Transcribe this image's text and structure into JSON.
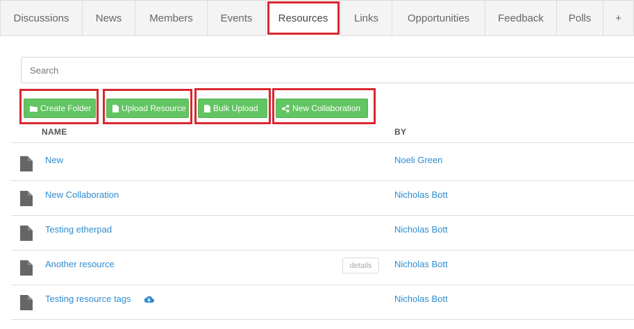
{
  "tabs": [
    {
      "label": "Discussions"
    },
    {
      "label": "News"
    },
    {
      "label": "Members"
    },
    {
      "label": "Events"
    },
    {
      "label": "Resources"
    },
    {
      "label": "Links"
    },
    {
      "label": "Opportunities"
    },
    {
      "label": "Feedback"
    },
    {
      "label": "Polls"
    },
    {
      "label": "+"
    }
  ],
  "active_tab": "Resources",
  "search": {
    "placeholder": "Search"
  },
  "actions": {
    "create_folder": "Create Folder",
    "upload_resource": "Upload Resource",
    "bulk_upload": "Bulk Upload",
    "new_collaboration": "New Collaboration"
  },
  "table": {
    "headers": {
      "name": "NAME",
      "by": "BY"
    },
    "rows": [
      {
        "name": "New",
        "by": "Noeli Green"
      },
      {
        "name": "New Collaboration",
        "by": "Nicholas Bott"
      },
      {
        "name": "Testing etherpad",
        "by": "Nicholas Bott"
      },
      {
        "name": "Another resource",
        "by": "Nicholas Bott",
        "details_label": "details"
      },
      {
        "name": "Testing resource tags",
        "by": "Nicholas Bott",
        "icon": "cloud-download-icon"
      }
    ]
  },
  "colors": {
    "accent_green": "#62c462",
    "link_blue": "#2e8ccf",
    "highlight_red": "#d9262f"
  }
}
